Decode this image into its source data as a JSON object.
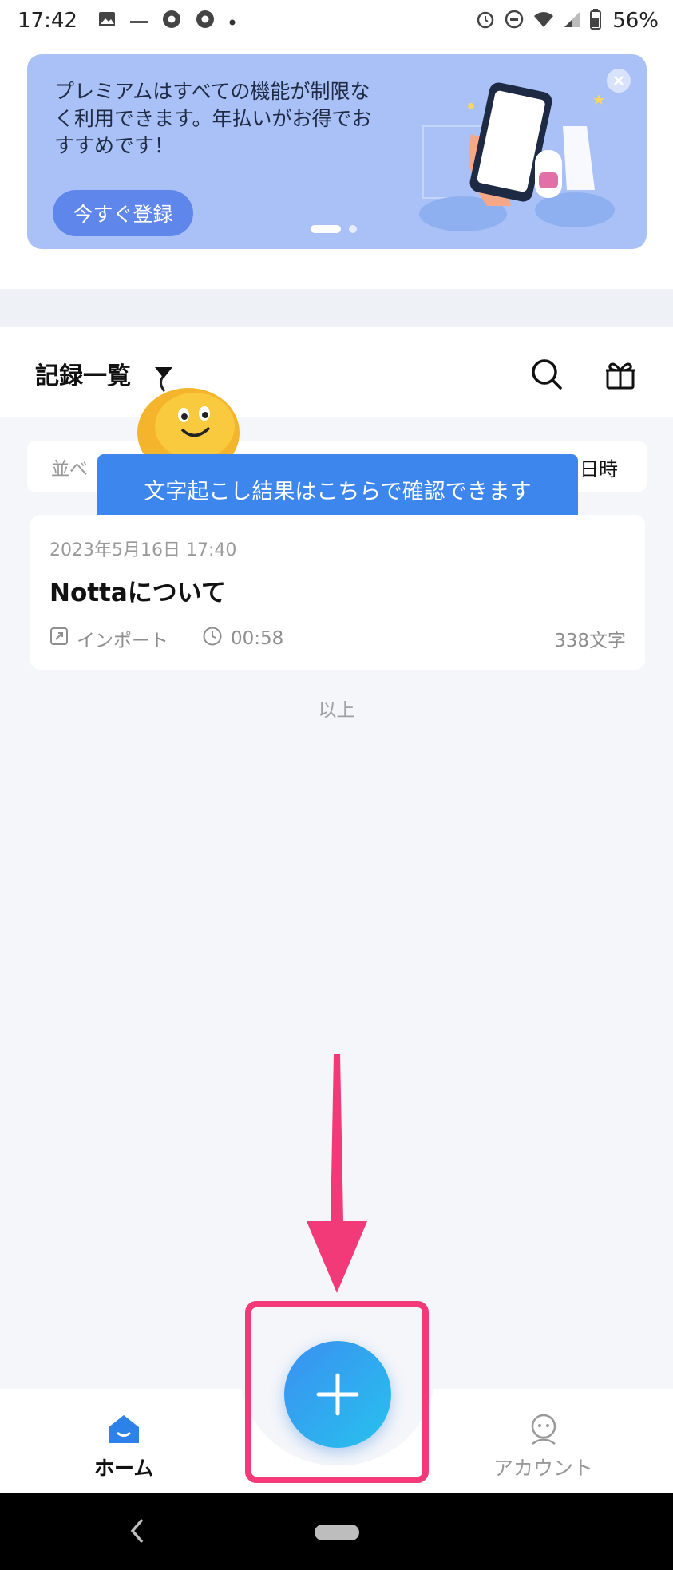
{
  "status_bar": {
    "time": "17:42",
    "battery": "56%"
  },
  "banner": {
    "text": "プレミアムはすべての機能が制限なく利用できます。年払いがお得でおすすめです！",
    "cta_label": "今すぐ登録"
  },
  "list_header": {
    "title": "記録一覧"
  },
  "sort_bar": {
    "left_label": "並べ",
    "right_label": "日時"
  },
  "tooltip": {
    "text": "文字起こし結果はこちらで確認できます"
  },
  "records": [
    {
      "datetime": "2023年5月16日  17:40",
      "title": "Nottaについて",
      "source": "インポート",
      "duration": "00:58",
      "char_count": "338文字"
    }
  ],
  "list_end_text": "以上",
  "bottom_nav": {
    "home_label": "ホーム",
    "account_label": "アカウント"
  },
  "colors": {
    "accent": "#3d86ee",
    "highlight": "#f23a78",
    "banner_bg": "#a9c1f6"
  }
}
